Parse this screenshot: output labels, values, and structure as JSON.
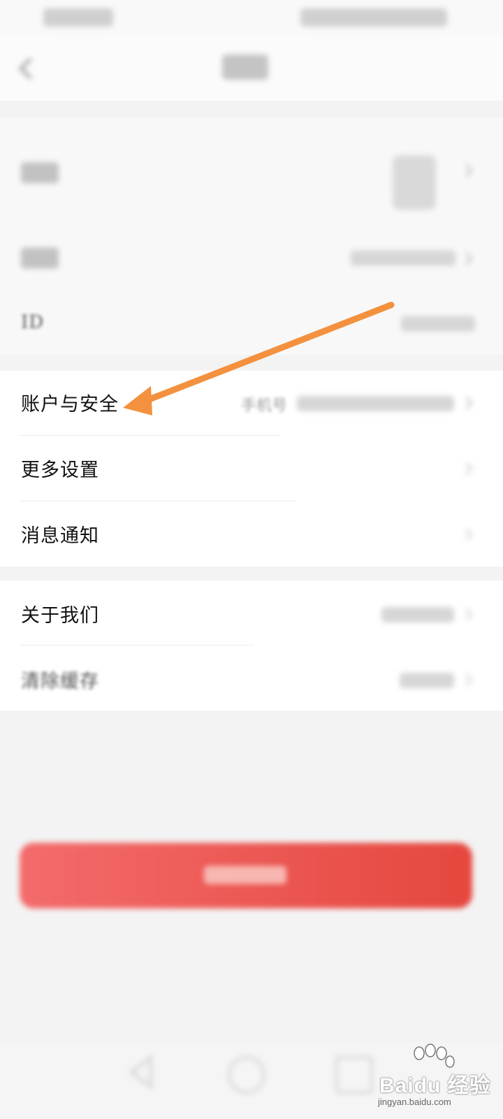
{
  "rows": {
    "id_label": "ID",
    "account_security": "账户与安全",
    "account_security_hint": "手机号",
    "more_settings": "更多设置",
    "message_notify": "消息通知",
    "about_us": "关于我们",
    "clear_cache": "清除缓存"
  },
  "watermark": {
    "main": "Baidu 经验",
    "url": "jingyan.baidu.com"
  },
  "colors": {
    "arrow": "#f3913e",
    "logout_start": "#f36b6b",
    "logout_end": "#e5473e"
  }
}
